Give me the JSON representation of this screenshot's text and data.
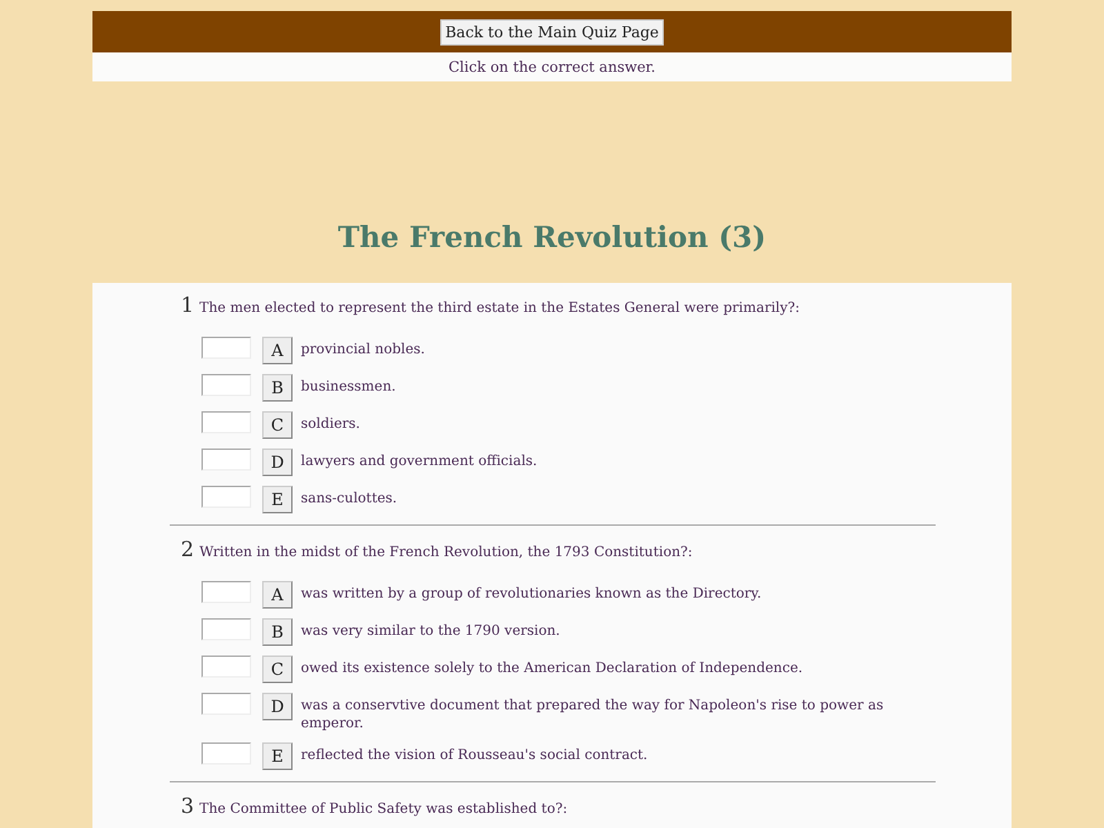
{
  "nav": {
    "back_button": "Back to the Main Quiz Page",
    "instruction": "Click on the correct answer."
  },
  "title": "The French Revolution (3)",
  "questions": [
    {
      "number": "1",
      "text": "The men elected to represent the third estate in the Estates General were primarily?:",
      "answers": [
        {
          "letter": "A",
          "text": "provincial nobles."
        },
        {
          "letter": "B",
          "text": "businessmen."
        },
        {
          "letter": "C",
          "text": "soldiers."
        },
        {
          "letter": "D",
          "text": "lawyers and government officials."
        },
        {
          "letter": "E",
          "text": "sans-culottes."
        }
      ]
    },
    {
      "number": "2",
      "text": "Written in the midst of the French Revolution, the 1793 Constitution?:",
      "answers": [
        {
          "letter": "A",
          "text": "was written by a group of revolutionaries known as the Directory."
        },
        {
          "letter": "B",
          "text": "was very similar to the 1790 version."
        },
        {
          "letter": "C",
          "text": "owed its existence solely to the American Declaration of Independence."
        },
        {
          "letter": "D",
          "text": "was a conservtive document that prepared the way for Napoleon's rise to power as emperor."
        },
        {
          "letter": "E",
          "text": "reflected the vision of Rousseau's social contract."
        }
      ]
    },
    {
      "number": "3",
      "text": "The Committee of Public Safety was established to?:"
    }
  ]
}
